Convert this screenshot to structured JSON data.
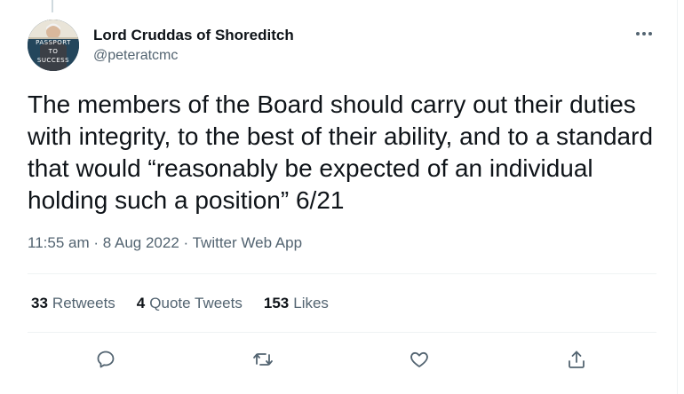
{
  "author": {
    "name": "Lord Cruddas of Shoreditch",
    "handle": "@peteratcmc",
    "avatar_book_lines": [
      "PASSPORT",
      "TO",
      "SUCCESS"
    ]
  },
  "tweet": {
    "text": "The members of the Board should carry out their duties with integrity, to the best of their ability, and to a standard that would “reasonably be expected of an individual holding such a position” 6/21",
    "time": "11:55 am",
    "date": "8 Aug 2022",
    "source": "Twitter Web App",
    "separator": "·"
  },
  "stats": {
    "retweets": {
      "count": "33",
      "label": "Retweets"
    },
    "quotes": {
      "count": "4",
      "label": "Quote Tweets"
    },
    "likes": {
      "count": "153",
      "label": "Likes"
    }
  },
  "icons": {
    "more": "more-icon",
    "reply": "reply-icon",
    "retweet": "retweet-icon",
    "like": "heart-icon",
    "share": "share-icon"
  },
  "colors": {
    "text_primary": "#0f1419",
    "text_secondary": "#536471",
    "divider": "#eff3f4"
  }
}
